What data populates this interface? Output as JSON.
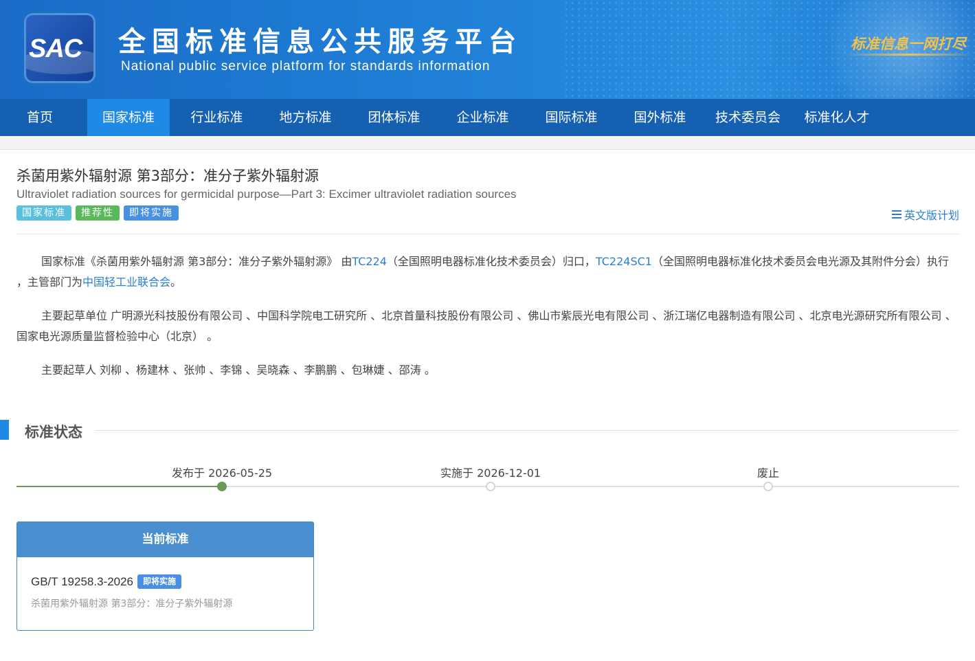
{
  "header": {
    "logo_text": "SAC",
    "title_cn": "全国标准信息公共服务平台",
    "title_en": "National public service platform  for standards information",
    "slogan": "标准信息一网打尽"
  },
  "nav": {
    "items": [
      {
        "label": "首页"
      },
      {
        "label": "国家标准"
      },
      {
        "label": "行业标准"
      },
      {
        "label": "地方标准"
      },
      {
        "label": "团体标准"
      },
      {
        "label": "企业标准"
      },
      {
        "label": "国际标准"
      },
      {
        "label": "国外标准"
      },
      {
        "label": "技术委员会"
      },
      {
        "label": "标准化人才"
      }
    ],
    "active_index": 1
  },
  "standard": {
    "title_cn": "杀菌用紫外辐射源 第3部分：准分子紫外辐射源",
    "title_en": "Ultraviolet radiation sources for germicidal purpose—Part 3: Excimer ultraviolet radiation sources",
    "tags": [
      "国家标准",
      "推荐性",
      "即将实施"
    ],
    "english_plan_label": "英文版计划"
  },
  "description": {
    "p1_prefix": "国家标准《杀菌用紫外辐射源 第3部分：准分子紫外辐射源》 由",
    "p1_tc": "TC224",
    "p1_tc_desc": "（全国照明电器标准化技术委员会）归口，",
    "p1_sc": "TC224SC1",
    "p1_sc_desc": "（全国照明电器标准化技术委员会电光源及其附件分会）执行 ，主管部门为",
    "p1_dept": "中国轻工业联合会",
    "p1_end": "。",
    "p2": "主要起草单位 广明源光科技股份有限公司 、中国科学院电工研究所 、北京首量科技股份有限公司 、佛山市紫辰光电有限公司 、浙江瑞亿电器制造有限公司 、北京电光源研究所有限公司 、国家电光源质量监督检验中心（北京） 。",
    "p3": "主要起草人 刘柳 、杨建林 、张帅 、李锦 、吴晓森 、李鹏鹏 、包琳婕 、邵涛 。"
  },
  "status_section": {
    "title": "标准状态",
    "timeline": [
      {
        "label": "发布于 2026-05-25",
        "done": true
      },
      {
        "label": "实施于 2026-12-01",
        "done": false
      },
      {
        "label": "废止",
        "done": false
      }
    ]
  },
  "current_card": {
    "header": "当前标准",
    "code": "GB/T 19258.3-2026",
    "badge": "即将实施",
    "name": "杀菌用紫外辐射源 第3部分：准分子紫外辐射源"
  }
}
